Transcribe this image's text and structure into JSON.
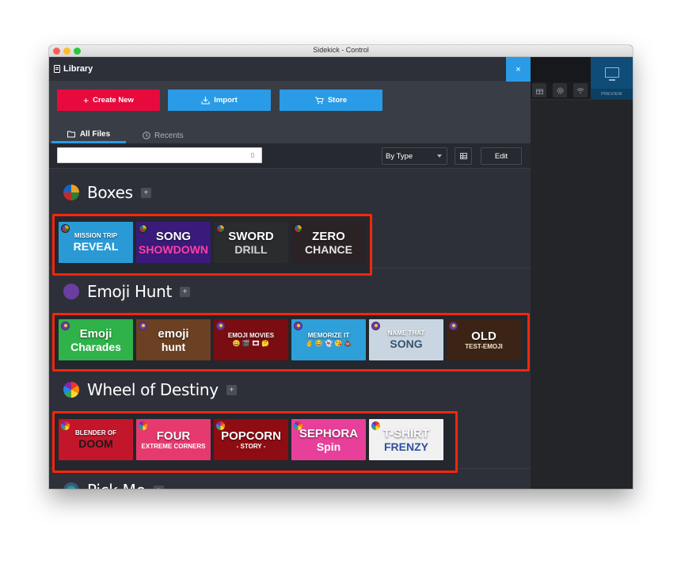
{
  "window": {
    "title": "Sidekick - Control"
  },
  "library": {
    "title": "Library",
    "close_label": "×",
    "buttons": {
      "create_new": "Create New",
      "create_icon": "+",
      "import": "Import",
      "store": "Store"
    },
    "tabs": [
      {
        "label": "All Files",
        "active": true
      },
      {
        "label": "Recents",
        "active": false
      }
    ],
    "search": {
      "value": "",
      "placeholder": ""
    },
    "sort_select": {
      "value": "By Type"
    },
    "edit_label": "Edit",
    "sections": [
      {
        "title": "Boxes",
        "add_label": "+",
        "icon": "boxes-game-icon",
        "tiles": [
          {
            "line1": "MISSION TRIP",
            "line2": "REVEAL",
            "bg": "#2a9ad6",
            "fg2": "#ffffff"
          },
          {
            "line1": "SONG",
            "line2": "SHOWDOWN",
            "bg": "#3a1a7a",
            "fg2": "#ff3fa5"
          },
          {
            "line1": "SWORD",
            "line2": "DRILL",
            "bg": "#2b2c2e",
            "fg2": "#d5d5d5"
          },
          {
            "line1": "ZERO",
            "line2": "CHANCE",
            "bg": "#2a2224",
            "fg2": "#e6e6e6"
          }
        ]
      },
      {
        "title": "Emoji Hunt",
        "add_label": "+",
        "icon": "emoji-hunt-game-icon",
        "tiles": [
          {
            "line1": "Emoji",
            "line2": "Charades",
            "bg": "#2fb24a",
            "fg2": "#ffffff"
          },
          {
            "line1": "emoji",
            "line2": "hunt",
            "bg": "#6b4023",
            "fg2": "#ffffff"
          },
          {
            "line1": "EMOJI MOVIES",
            "line2": "😀 🎬 🎞 🤔",
            "bg": "#7a0d12",
            "fg2": "#ffffff"
          },
          {
            "line1": "MEMORIZE IT",
            "line2": "✌ 😂 👻 😘 💩",
            "bg": "#2e9fd8",
            "fg2": "#ffffff"
          },
          {
            "line1": "NAME THAT",
            "line2": "SONG",
            "bg": "#c9d6e2",
            "fg2": "#35536f"
          },
          {
            "line1": "OLD",
            "line2": "TEST-EMOJI",
            "bg": "#3b2415",
            "fg2": "#f2e6c9"
          }
        ]
      },
      {
        "title": "Wheel of Destiny",
        "add_label": "+",
        "icon": "wheel-of-destiny-game-icon",
        "tiles": [
          {
            "line1": "BLENDER OF",
            "line2": "DOOM",
            "bg": "#c4162b",
            "fg2": "#1a1a1a"
          },
          {
            "line1": "FOUR",
            "line2": "EXTREME CORNERS",
            "bg": "#e63a6f",
            "fg2": "#ffffff"
          },
          {
            "line1": "POPCORN",
            "line2": "- STORY -",
            "bg": "#8e0d12",
            "fg2": "#ffffff"
          },
          {
            "line1": "SEPHORA",
            "line2": "Spin",
            "bg": "#e8409a",
            "fg2": "#ffffff"
          },
          {
            "line1": "T-SHIRT",
            "line2": "FRENZY",
            "bg": "#f1f1f1",
            "fg2": "#2d4fa3"
          }
        ]
      },
      {
        "title": "Pick Me",
        "add_label": "+",
        "icon": "pick-me-game-icon",
        "tiles": []
      }
    ]
  },
  "right_panel": {
    "preview_label": "PREVIEW",
    "icons": [
      "gift-icon",
      "gear-icon",
      "wifi-icon",
      "monitor-icon"
    ]
  },
  "colors": {
    "accent_blue": "#2a9be6",
    "create_red": "#e8093d",
    "highlight_red": "#f5260c",
    "panel_bg": "#2d3038"
  }
}
